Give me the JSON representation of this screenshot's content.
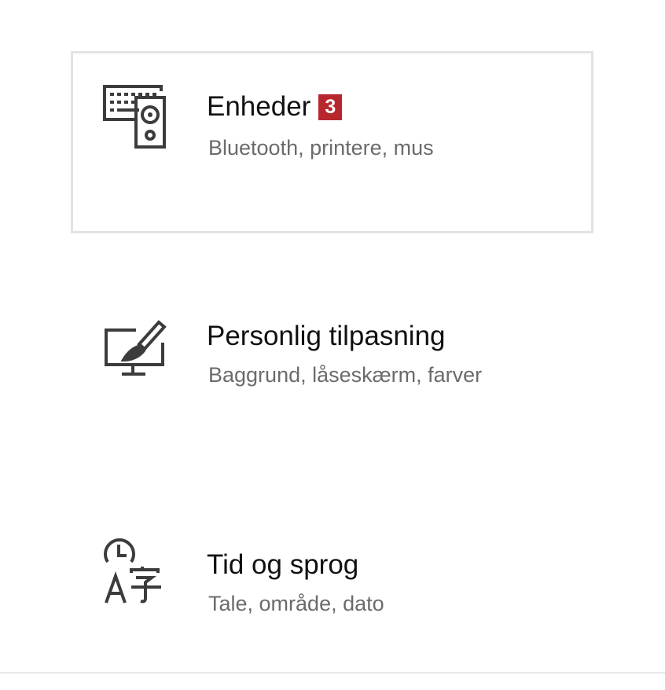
{
  "tiles": [
    {
      "title": "Enheder",
      "badge": "3",
      "subtitle": "Bluetooth, printere, mus",
      "icon": "devices-icon",
      "selected": true
    },
    {
      "title": "Personlig tilpasning",
      "subtitle": "Baggrund, låseskærm, farver",
      "icon": "personalization-icon",
      "selected": false
    },
    {
      "title": "Tid og sprog",
      "subtitle": "Tale, område, dato",
      "icon": "time-language-icon",
      "selected": false
    }
  ],
  "colors": {
    "badge": "#b7282e",
    "title": "#111111",
    "subtitle": "#6b6b6b",
    "icon": "#3c3c3c",
    "selected_border": "#e3e3e3"
  }
}
